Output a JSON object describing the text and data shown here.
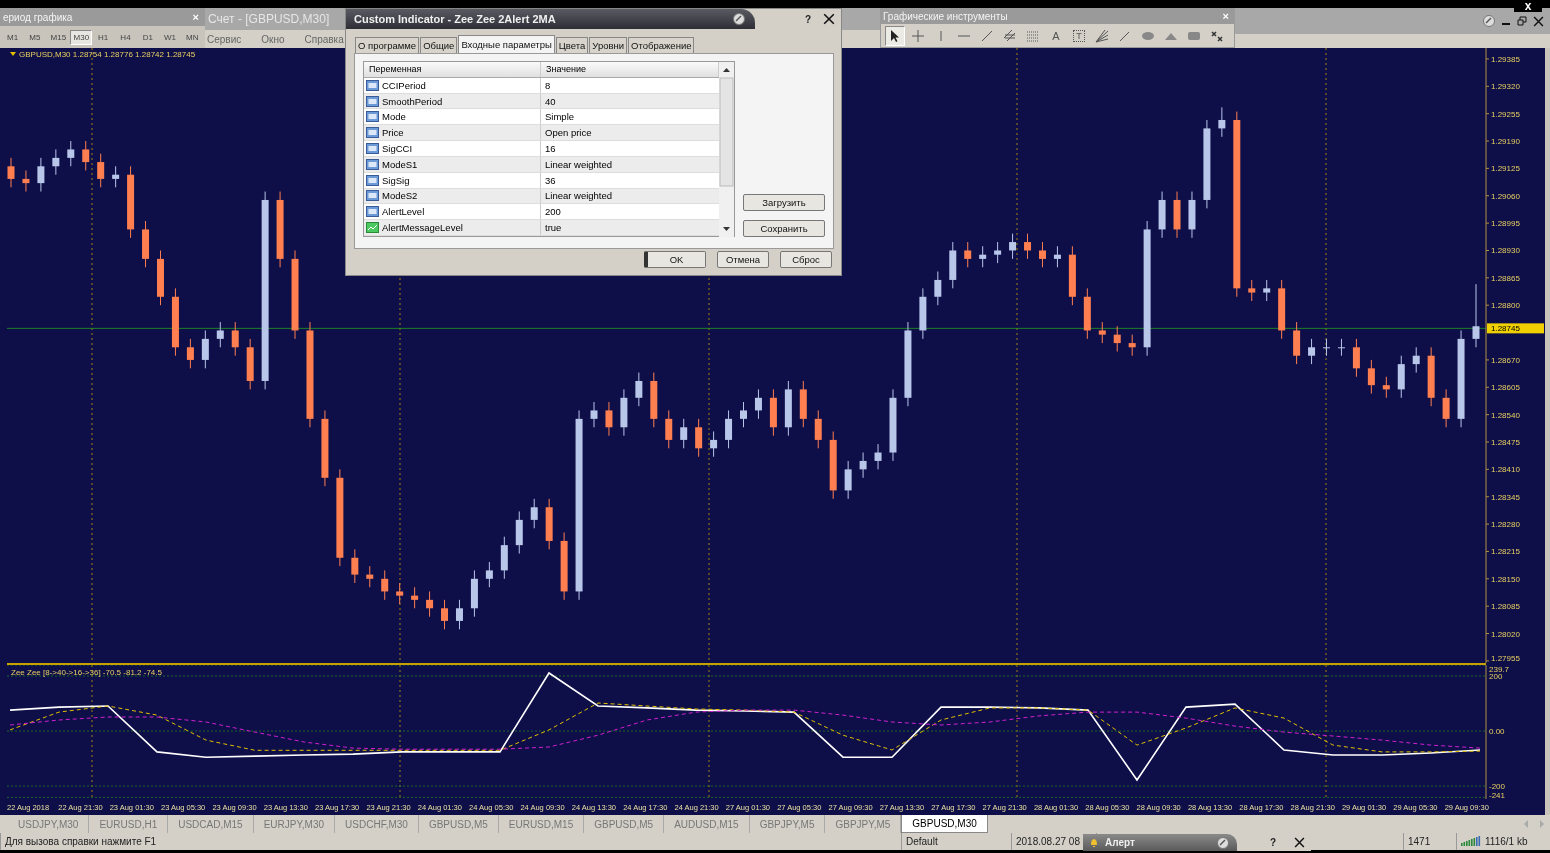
{
  "top_strip": {
    "close_label": "x"
  },
  "timeframes_panel": {
    "title": "ериод графика",
    "close": "×",
    "items": [
      {
        "label": "M1",
        "selected": false
      },
      {
        "label": "M5",
        "selected": false
      },
      {
        "label": "M15",
        "selected": false
      },
      {
        "label": "M30",
        "selected": true
      },
      {
        "label": "H1",
        "selected": false
      },
      {
        "label": "H4",
        "selected": false
      },
      {
        "label": "D1",
        "selected": false
      },
      {
        "label": "W1",
        "selected": false
      },
      {
        "label": "MN",
        "selected": false
      }
    ]
  },
  "app_title": "Счет - [GBPUSD,M30]",
  "menu": [
    "Сервис",
    "Окно",
    "Справка"
  ],
  "drawing_tools": {
    "title": "Графические инструменты",
    "close": "×",
    "tools": [
      {
        "kind": "cursor",
        "selected": true
      },
      {
        "kind": "crosshair",
        "selected": false
      },
      {
        "kind": "vertical-line",
        "selected": false
      },
      {
        "kind": "horizontal-line",
        "selected": false
      },
      {
        "kind": "trend-line",
        "selected": false
      },
      {
        "kind": "channel",
        "selected": false
      },
      {
        "kind": "grid",
        "selected": false
      },
      {
        "kind": "text",
        "label": "A",
        "selected": false
      },
      {
        "kind": "label",
        "label": "T",
        "selected": false
      },
      {
        "kind": "fan",
        "selected": false
      },
      {
        "kind": "angle",
        "selected": false
      },
      {
        "kind": "ellipse",
        "selected": false
      },
      {
        "kind": "triangle",
        "selected": false
      },
      {
        "kind": "rectangle",
        "selected": false
      },
      {
        "kind": "arrows",
        "selected": false
      }
    ]
  },
  "dialog": {
    "title": "Custom Indicator - Zee Zee 2Alert 2MA",
    "help": "?",
    "tabs": [
      {
        "label": "О программе",
        "selected": false
      },
      {
        "label": "Общие",
        "selected": false
      },
      {
        "label": "Входные параметры",
        "selected": true
      },
      {
        "label": "Цвета",
        "selected": false
      },
      {
        "label": "Уровни",
        "selected": false
      },
      {
        "label": "Отображение",
        "selected": false
      }
    ],
    "table": {
      "columns": [
        "Переменная",
        "Значение"
      ],
      "rows": [
        {
          "kind": "number",
          "name": "CCIPeriod",
          "value": "8"
        },
        {
          "kind": "number",
          "name": "SmoothPeriod",
          "value": "40"
        },
        {
          "kind": "number",
          "name": "Mode",
          "value": "Simple"
        },
        {
          "kind": "number",
          "name": "Price",
          "value": "Open price"
        },
        {
          "kind": "number",
          "name": "SigCCI",
          "value": "16"
        },
        {
          "kind": "number",
          "name": "ModeS1",
          "value": "Linear weighted"
        },
        {
          "kind": "number",
          "name": "SigSig",
          "value": "36"
        },
        {
          "kind": "number",
          "name": "ModeS2",
          "value": "Linear weighted"
        },
        {
          "kind": "number",
          "name": "AlertLevel",
          "value": "200"
        },
        {
          "kind": "bool",
          "name": "AlertMessageLevel",
          "value": "true"
        }
      ]
    },
    "side_buttons": [
      "Загрузить",
      "Сохранить"
    ],
    "buttons": [
      "OK",
      "Отмена",
      "Сброс"
    ]
  },
  "chart": {
    "header": "GBPUSD,M30  1.28754 1.28776 1.28742 1.28745",
    "current_price": "1.28745",
    "chart_data": {
      "type": "candlestick",
      "ylim": [
        1.2795,
        1.29411
      ],
      "yticks": [
        {
          "value": 1.29385,
          "label": "1.29385"
        },
        {
          "value": 1.2932,
          "label": "1.29320"
        },
        {
          "value": 1.29255,
          "label": "1.29255"
        },
        {
          "value": 1.2919,
          "label": "1.29190"
        },
        {
          "value": 1.29125,
          "label": "1.29125"
        },
        {
          "value": 1.2906,
          "label": "1.29060"
        },
        {
          "value": 1.28995,
          "label": "1.28995"
        },
        {
          "value": 1.2893,
          "label": "1.28930"
        },
        {
          "value": 1.28865,
          "label": "1.28865"
        },
        {
          "value": 1.288,
          "label": "1.28800"
        },
        {
          "value": 1.2867,
          "label": "1.28670"
        },
        {
          "value": 1.28605,
          "label": "1.28605"
        },
        {
          "value": 1.2854,
          "label": "1.28540"
        },
        {
          "value": 1.28475,
          "label": "1.28475"
        },
        {
          "value": 1.2841,
          "label": "1.28410"
        },
        {
          "value": 1.28345,
          "label": "1.28345"
        },
        {
          "value": 1.2828,
          "label": "1.28280"
        },
        {
          "value": 1.28215,
          "label": "1.28215"
        },
        {
          "value": 1.2815,
          "label": "1.28150"
        },
        {
          "value": 1.28085,
          "label": "1.28085"
        },
        {
          "value": 1.2802,
          "label": "1.28020"
        },
        {
          "value": 1.27955,
          "label": "1.27955"
        }
      ],
      "ref_lines": [
        {
          "axis": "y",
          "value": 1.28745
        }
      ],
      "ohlc": [
        [
          1.2913,
          1.2915,
          1.2908,
          1.291
        ],
        [
          1.291,
          1.2912,
          1.2907,
          1.2909
        ],
        [
          1.2909,
          1.2915,
          1.2907,
          1.2913
        ],
        [
          1.2913,
          1.2917,
          1.2911,
          1.2915
        ],
        [
          1.2915,
          1.2919,
          1.2913,
          1.2917
        ],
        [
          1.2917,
          1.2919,
          1.2912,
          1.2914
        ],
        [
          1.2914,
          1.2916,
          1.2908,
          1.291
        ],
        [
          1.291,
          1.2913,
          1.2908,
          1.2911
        ],
        [
          1.2911,
          1.2913,
          1.2896,
          1.2898
        ],
        [
          1.2898,
          1.29,
          1.2889,
          1.2891
        ],
        [
          1.2891,
          1.2893,
          1.288,
          1.2882
        ],
        [
          1.2882,
          1.2884,
          1.2868,
          1.287
        ],
        [
          1.287,
          1.2872,
          1.2865,
          1.2867
        ],
        [
          1.2867,
          1.2874,
          1.2865,
          1.2872
        ],
        [
          1.2872,
          1.2876,
          1.287,
          1.2874
        ],
        [
          1.2874,
          1.2876,
          1.2868,
          1.287
        ],
        [
          1.287,
          1.2872,
          1.286,
          1.2862
        ],
        [
          1.2862,
          1.2907,
          1.286,
          1.2905
        ],
        [
          1.2905,
          1.2907,
          1.2889,
          1.2891
        ],
        [
          1.2891,
          1.2893,
          1.2872,
          1.2874
        ],
        [
          1.2874,
          1.2876,
          1.2851,
          1.2853
        ],
        [
          1.2853,
          1.2855,
          1.2837,
          1.2839
        ],
        [
          1.2839,
          1.2841,
          1.2818,
          1.282
        ],
        [
          1.282,
          1.2822,
          1.2814,
          1.2816
        ],
        [
          1.2816,
          1.2818,
          1.2813,
          1.2815
        ],
        [
          1.2815,
          1.2817,
          1.281,
          1.2812
        ],
        [
          1.2812,
          1.2814,
          1.2809,
          1.2811
        ],
        [
          1.2811,
          1.2813,
          1.2808,
          1.281
        ],
        [
          1.281,
          1.2812,
          1.2806,
          1.2808
        ],
        [
          1.2808,
          1.281,
          1.2803,
          1.2805
        ],
        [
          1.2805,
          1.281,
          1.2803,
          1.2808
        ],
        [
          1.2808,
          1.2817,
          1.2806,
          1.2815
        ],
        [
          1.2815,
          1.2819,
          1.2813,
          1.2817
        ],
        [
          1.2817,
          1.2825,
          1.2815,
          1.2823
        ],
        [
          1.2823,
          1.2831,
          1.2821,
          1.2829
        ],
        [
          1.2829,
          1.2834,
          1.2827,
          1.2832
        ],
        [
          1.2832,
          1.2834,
          1.2822,
          1.2824
        ],
        [
          1.2824,
          1.2826,
          1.281,
          1.2812
        ],
        [
          1.2812,
          1.2855,
          1.281,
          1.2853
        ],
        [
          1.2853,
          1.2857,
          1.2851,
          1.2855
        ],
        [
          1.2855,
          1.2857,
          1.2849,
          1.2851
        ],
        [
          1.2851,
          1.286,
          1.2849,
          1.2858
        ],
        [
          1.2858,
          1.2864,
          1.2856,
          1.2862
        ],
        [
          1.2862,
          1.2864,
          1.2851,
          1.2853
        ],
        [
          1.2853,
          1.2855,
          1.2846,
          1.2848
        ],
        [
          1.2848,
          1.2853,
          1.2846,
          1.2851
        ],
        [
          1.2851,
          1.2853,
          1.2844,
          1.2846
        ],
        [
          1.2846,
          1.285,
          1.2844,
          1.2848
        ],
        [
          1.2848,
          1.2855,
          1.2846,
          1.2853
        ],
        [
          1.2853,
          1.2857,
          1.2851,
          1.2855
        ],
        [
          1.2855,
          1.286,
          1.2853,
          1.2858
        ],
        [
          1.2858,
          1.286,
          1.2849,
          1.2851
        ],
        [
          1.2851,
          1.2862,
          1.2849,
          1.286
        ],
        [
          1.286,
          1.2862,
          1.2851,
          1.2853
        ],
        [
          1.2853,
          1.2855,
          1.2846,
          1.2848
        ],
        [
          1.2848,
          1.285,
          1.2834,
          1.2836
        ],
        [
          1.2836,
          1.2843,
          1.2834,
          1.2841
        ],
        [
          1.2841,
          1.2845,
          1.2839,
          1.2843
        ],
        [
          1.2843,
          1.2847,
          1.2841,
          1.2845
        ],
        [
          1.2845,
          1.286,
          1.2843,
          1.2858
        ],
        [
          1.2858,
          1.2876,
          1.2856,
          1.2874
        ],
        [
          1.2874,
          1.2884,
          1.2872,
          1.2882
        ],
        [
          1.2882,
          1.2888,
          1.288,
          1.2886
        ],
        [
          1.2886,
          1.2895,
          1.2884,
          1.2893
        ],
        [
          1.2893,
          1.2895,
          1.2889,
          1.2891
        ],
        [
          1.2891,
          1.2894,
          1.2889,
          1.2892
        ],
        [
          1.2892,
          1.2895,
          1.289,
          1.2893
        ],
        [
          1.2893,
          1.2897,
          1.2891,
          1.2895
        ],
        [
          1.2895,
          1.2897,
          1.2891,
          1.2893
        ],
        [
          1.2893,
          1.2895,
          1.2889,
          1.2891
        ],
        [
          1.2891,
          1.2894,
          1.2889,
          1.2892
        ],
        [
          1.2892,
          1.2894,
          1.288,
          1.2882
        ],
        [
          1.2882,
          1.2884,
          1.2872,
          1.2874
        ],
        [
          1.2874,
          1.2876,
          1.2871,
          1.2873
        ],
        [
          1.2873,
          1.2875,
          1.2869,
          1.2871
        ],
        [
          1.2871,
          1.2873,
          1.2868,
          1.287
        ],
        [
          1.287,
          1.29,
          1.2868,
          1.2898
        ],
        [
          1.2898,
          1.2907,
          1.2896,
          1.2905
        ],
        [
          1.2905,
          1.2907,
          1.2896,
          1.2898
        ],
        [
          1.2898,
          1.2907,
          1.2896,
          1.2905
        ],
        [
          1.2905,
          1.2924,
          1.2903,
          1.2922
        ],
        [
          1.2922,
          1.2927,
          1.292,
          1.2924
        ],
        [
          1.2924,
          1.2926,
          1.2882,
          1.2884
        ],
        [
          1.2884,
          1.2886,
          1.2881,
          1.2883
        ],
        [
          1.2883,
          1.2886,
          1.2881,
          1.2884
        ],
        [
          1.2884,
          1.2886,
          1.2872,
          1.2874
        ],
        [
          1.2874,
          1.2876,
          1.2866,
          1.2868
        ],
        [
          1.2868,
          1.2872,
          1.2866,
          1.287
        ],
        [
          1.287,
          1.2872,
          1.2868,
          1.287
        ],
        [
          1.287,
          1.2872,
          1.2868,
          1.287
        ],
        [
          1.287,
          1.2872,
          1.2863,
          1.2865
        ],
        [
          1.2865,
          1.2867,
          1.2859,
          1.2861
        ],
        [
          1.2861,
          1.2863,
          1.2858,
          1.286
        ],
        [
          1.286,
          1.2868,
          1.2858,
          1.2866
        ],
        [
          1.2866,
          1.287,
          1.2864,
          1.2868
        ],
        [
          1.2868,
          1.287,
          1.2856,
          1.2858
        ],
        [
          1.2858,
          1.286,
          1.2851,
          1.2853
        ],
        [
          1.2853,
          1.2874,
          1.2851,
          1.2872
        ],
        [
          1.2872,
          1.2885,
          1.287,
          1.2875
        ]
      ]
    }
  },
  "indicator": {
    "header": "Zee Zee [8->40->16->36] -70.5 -81.2 -74.5",
    "chart_data": {
      "type": "line",
      "ylim": [
        -247,
        240
      ],
      "grid": true,
      "yticks": [
        {
          "value": 239.7,
          "label": "239.7"
        },
        {
          "value": 200,
          "label": "200"
        },
        {
          "value": 0,
          "label": "0.00"
        },
        {
          "value": -200,
          "label": "-200"
        },
        {
          "value": -241,
          "label": "-241"
        }
      ],
      "series": [
        {
          "color": "#ffffff",
          "line_style": "solid",
          "values": [
            76,
            87,
            91,
            -76,
            -95,
            -91,
            -87,
            -84,
            -76,
            -76,
            -76,
            211,
            91,
            84,
            76,
            73,
            69,
            -95,
            -95,
            87,
            87,
            84,
            76,
            -178,
            87,
            98,
            -69,
            -87,
            -87,
            -80,
            -69
          ]
        },
        {
          "color": "#e0c000",
          "line_style": "dashed",
          "values": [
            4,
            69,
            91,
            58,
            -33,
            -70,
            -70,
            -70,
            -70,
            -70,
            -70,
            4,
            102,
            91,
            80,
            76,
            69,
            -15,
            -69,
            40,
            84,
            84,
            76,
            -51,
            11,
            84,
            47,
            -51,
            -76,
            -76,
            -73
          ]
        },
        {
          "color": "#d020d0",
          "line_style": "dashed",
          "values": [
            22,
            40,
            51,
            51,
            33,
            -4,
            -40,
            -62,
            -66,
            -66,
            -66,
            -58,
            -15,
            40,
            69,
            76,
            76,
            58,
            33,
            22,
            33,
            55,
            69,
            69,
            47,
            18,
            -4,
            -18,
            -33,
            -51,
            -62
          ]
        }
      ]
    }
  },
  "time_axis": [
    "22 Aug 2018",
    "22 Aug 21:30",
    "23 Aug 01:30",
    "23 Aug 05:30",
    "23 Aug 09:30",
    "23 Aug 13:30",
    "23 Aug 17:30",
    "23 Aug 21:30",
    "24 Aug 01:30",
    "24 Aug 05:30",
    "24 Aug 09:30",
    "24 Aug 13:30",
    "24 Aug 17:30",
    "24 Aug 21:30",
    "27 Aug 01:30",
    "27 Aug 05:30",
    "27 Aug 09:30",
    "27 Aug 13:30",
    "27 Aug 17:30",
    "27 Aug 21:30",
    "28 Aug 01:30",
    "28 Aug 05:30",
    "28 Aug 09:30",
    "28 Aug 13:30",
    "28 Aug 17:30",
    "28 Aug 21:30",
    "29 Aug 01:30",
    "29 Aug 05:30",
    "29 Aug 09:30"
  ],
  "symbol_tabs": [
    {
      "label": "USDJPY,M30",
      "selected": false
    },
    {
      "label": "EURUSD,H1",
      "selected": false
    },
    {
      "label": "USDCAD,M15",
      "selected": false
    },
    {
      "label": "EURJPY,M30",
      "selected": false
    },
    {
      "label": "USDCHF,M30",
      "selected": false
    },
    {
      "label": "GBPUSD,M5",
      "selected": false
    },
    {
      "label": "EURUSD,M15",
      "selected": false
    },
    {
      "label": "GBPUSD,M5",
      "selected": false
    },
    {
      "label": "AUDUSD,M15",
      "selected": false
    },
    {
      "label": "GBPJPY,M5",
      "selected": false
    },
    {
      "label": "GBPJPY,M5",
      "selected": false
    },
    {
      "label": "GBPUSD,M30",
      "selected": true
    }
  ],
  "status_bar": {
    "help": "Для вызова справки нажмите F1",
    "profile": "Default",
    "time": "2018.08.27 08",
    "bars": "1471",
    "traffic": "1116/1 kb"
  },
  "alert_window": {
    "title": "Алерт",
    "help": "?"
  }
}
